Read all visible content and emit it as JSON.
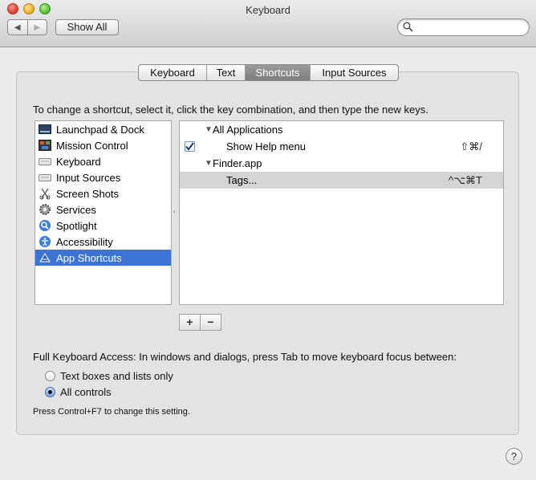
{
  "window": {
    "title": "Keyboard"
  },
  "toolbar": {
    "back_label": "◀",
    "forward_label": "▶",
    "show_all_label": "Show All",
    "search_value": "",
    "search_placeholder": ""
  },
  "tabs": [
    {
      "label": "Keyboard",
      "selected": false
    },
    {
      "label": "Text",
      "selected": false
    },
    {
      "label": "Shortcuts",
      "selected": true
    },
    {
      "label": "Input Sources",
      "selected": false
    }
  ],
  "instructions": "To change a shortcut, select it, click the key combination, and then type the new keys.",
  "categories": [
    {
      "label": "Launchpad & Dock",
      "icon": "launchpad-dock-icon",
      "selected": false
    },
    {
      "label": "Mission Control",
      "icon": "mission-control-icon",
      "selected": false
    },
    {
      "label": "Keyboard",
      "icon": "keyboard-icon",
      "selected": false
    },
    {
      "label": "Input Sources",
      "icon": "input-sources-icon",
      "selected": false
    },
    {
      "label": "Screen Shots",
      "icon": "screen-shots-icon",
      "selected": false
    },
    {
      "label": "Services",
      "icon": "gear-icon",
      "selected": false
    },
    {
      "label": "Spotlight",
      "icon": "spotlight-icon",
      "selected": false
    },
    {
      "label": "Accessibility",
      "icon": "accessibility-icon",
      "selected": false
    },
    {
      "label": "App Shortcuts",
      "icon": "app-shortcuts-icon",
      "selected": true
    }
  ],
  "shortcuts": [
    {
      "type": "group",
      "label": "All Applications",
      "expanded": true
    },
    {
      "type": "item",
      "label": "Show Help menu",
      "keys": "⇧⌘/",
      "checked": true,
      "selected": false
    },
    {
      "type": "group",
      "label": "Finder.app",
      "expanded": true
    },
    {
      "type": "item",
      "label": "Tags...",
      "keys": "^⌥⌘T",
      "checked": false,
      "selected": true
    }
  ],
  "buttons": {
    "add_label": "+",
    "remove_label": "−"
  },
  "keyboard_access": {
    "label": "Full Keyboard Access: In windows and dialogs, press Tab to move keyboard focus between:",
    "options": [
      {
        "label": "Text boxes and lists only",
        "selected": false
      },
      {
        "label": "All controls",
        "selected": true
      }
    ],
    "note": "Press Control+F7 to change this setting."
  },
  "help_label": "?"
}
